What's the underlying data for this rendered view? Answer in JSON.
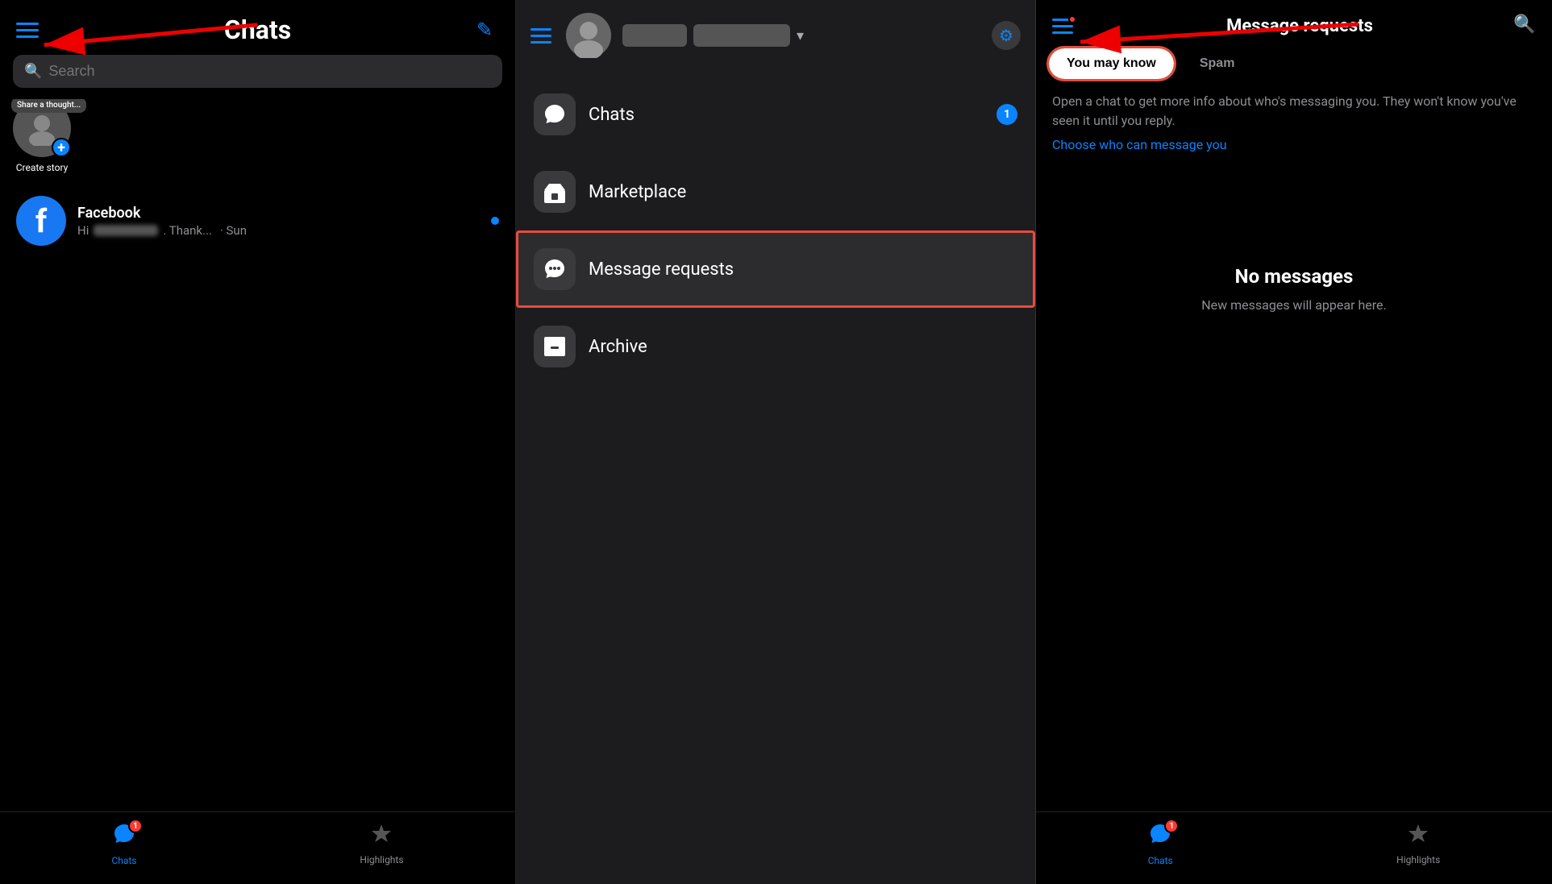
{
  "panel1": {
    "title": "Chats",
    "search_placeholder": "Search",
    "story": {
      "tooltip": "Share a thought...",
      "label": "Create story"
    },
    "chats": [
      {
        "name": "Facebook",
        "preview": "Hi [BLURRED]. Thank...",
        "time": "Sun",
        "has_unread": true,
        "avatar_type": "facebook"
      }
    ],
    "nav": {
      "chats_label": "Chats",
      "highlights_label": "Highlights",
      "chats_badge": "1"
    }
  },
  "panel2": {
    "menu_items": [
      {
        "id": "chats",
        "label": "Chats",
        "icon": "💬",
        "badge": "1"
      },
      {
        "id": "marketplace",
        "label": "Marketplace",
        "icon": "🏪",
        "badge": null
      },
      {
        "id": "message-requests",
        "label": "Message requests",
        "icon": "💬",
        "badge": null,
        "selected": true
      },
      {
        "id": "archive",
        "label": "Archive",
        "icon": "📦",
        "badge": null
      }
    ]
  },
  "panel3": {
    "title": "Message requests",
    "tab_you_may_know": "You may know",
    "tab_spam": "Spam",
    "info_text": "Open a chat to get more info about who's messaging you. They won't know you've seen it until you reply.",
    "info_link": "Choose who can message you",
    "empty_title": "No messages",
    "empty_sub": "New messages will appear here.",
    "nav": {
      "chats_label": "Chats",
      "highlights_label": "Highlights",
      "chats_badge": "1"
    }
  },
  "icons": {
    "hamburger": "☰",
    "edit": "✏",
    "search": "🔍",
    "gear": "⚙",
    "bolt": "⚡",
    "chat_bubble": "💬",
    "marketplace": "🏪",
    "archive": "📦"
  },
  "colors": {
    "blue": "#0a84ff",
    "red": "#e74c3c",
    "dark_bg": "#1c1c1e",
    "badge_red": "#ff3b30"
  }
}
